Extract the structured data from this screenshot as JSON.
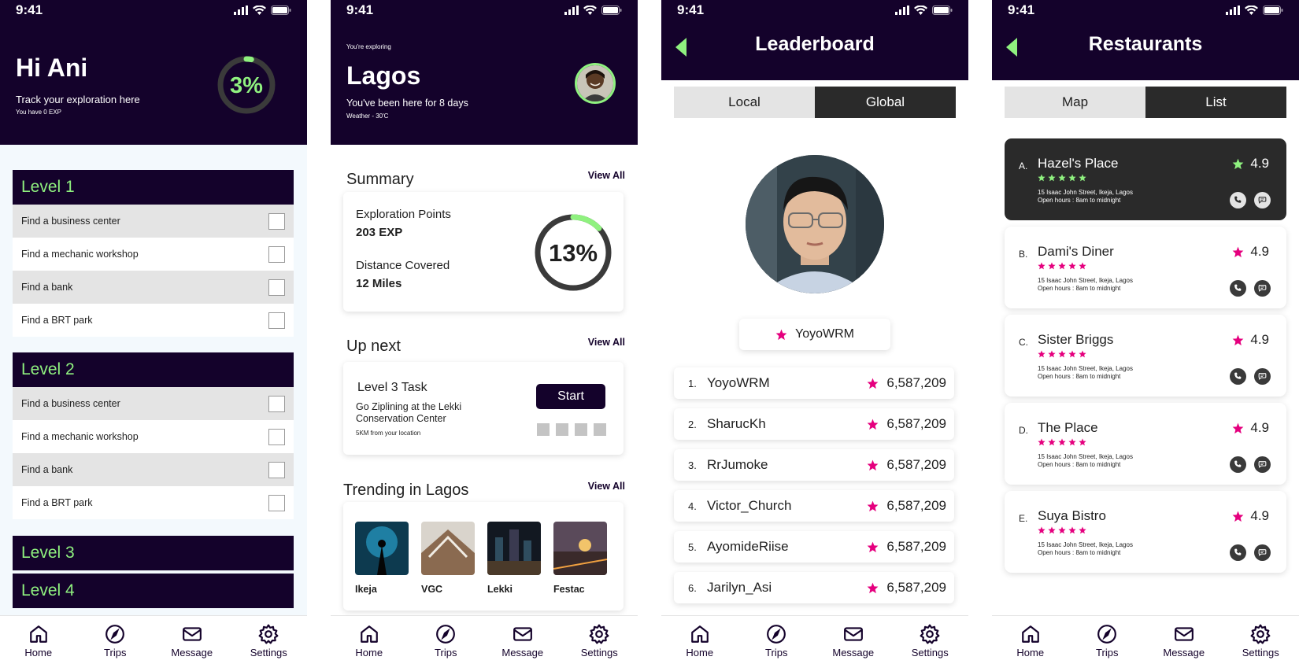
{
  "status_time": "9:41",
  "nav": [
    "Home",
    "Trips",
    "Message",
    "Settings"
  ],
  "colors": {
    "navy": "#14022b",
    "accent_green": "#8ff17f",
    "star_pink": "#e5007e",
    "dark_card": "#2a2a2a"
  },
  "screen1": {
    "greeting": "Hi Ani",
    "subtitle": "Track your exploration here",
    "exp_note": "You have 0 EXP",
    "progress_label": "3%",
    "progress": 0.03,
    "levels": [
      {
        "title": "Level 1",
        "tasks": [
          "Find a business center",
          "Find a mechanic workshop",
          "Find a bank",
          "Find a BRT park"
        ]
      },
      {
        "title": "Level 2",
        "tasks": [
          "Find a business center",
          "Find a mechanic workshop",
          "Find a bank",
          "Find a BRT park"
        ]
      },
      {
        "title": "Level 3"
      },
      {
        "title": "Level 4"
      }
    ]
  },
  "screen2": {
    "pre": "You're exploring",
    "city": "Lagos",
    "stay": "You've been here for 8 days",
    "weather": "Weather - 30'C",
    "summary_title": "Summary",
    "view_all": "View All",
    "exp_label": "Exploration Points",
    "exp_value": "203 EXP",
    "dist_label": "Distance Covered",
    "dist_value": "12 Miles",
    "progress_label": "13%",
    "progress": 0.13,
    "upnext_title": "Up next",
    "task_title": "Level 3 Task",
    "task_desc": "Go Ziplining at the Lekki Conservation Center",
    "task_dist": "5KM from your location",
    "start": "Start",
    "trending_title": "Trending in Lagos",
    "places": [
      "Ikeja",
      "VGC",
      "Lekki",
      "Festac"
    ]
  },
  "screen3": {
    "title": "Leaderboard",
    "tabs": [
      "Local",
      "Global"
    ],
    "active_tab": "Global",
    "user": "YoyoWRM",
    "rows": [
      {
        "rank": "1.",
        "name": "YoyoWRM",
        "score": "6,587,209"
      },
      {
        "rank": "2.",
        "name": "SharucKh",
        "score": "6,587,209"
      },
      {
        "rank": "3.",
        "name": "RrJumoke",
        "score": "6,587,209"
      },
      {
        "rank": "4.",
        "name": "Victor_Church",
        "score": "6,587,209"
      },
      {
        "rank": "5.",
        "name": "AyomideRiise",
        "score": "6,587,209"
      },
      {
        "rank": "6.",
        "name": "Jarilyn_Asi",
        "score": "6,587,209"
      }
    ]
  },
  "screen4": {
    "title": "Restaurants",
    "tabs": [
      "Map",
      "List"
    ],
    "active_tab": "List",
    "items": [
      {
        "letter": "A.",
        "name": "Hazel's Place",
        "rating": "4.9",
        "stars": 5,
        "address": "15 Isaac John Street, Ikeja, Lagos",
        "hours": "Open hours : 8am to midnight",
        "selected": true
      },
      {
        "letter": "B.",
        "name": "Dami's Diner",
        "rating": "4.9",
        "stars": 5,
        "address": "15 Isaac John Street, Ikeja, Lagos",
        "hours": "Open hours : 8am to midnight"
      },
      {
        "letter": "C.",
        "name": "Sister Briggs",
        "rating": "4.9",
        "stars": 5,
        "address": "15 Isaac John Street, Ikeja, Lagos",
        "hours": "Open hours : 8am to midnight"
      },
      {
        "letter": "D.",
        "name": "The Place",
        "rating": "4.9",
        "stars": 5,
        "address": "15 Isaac John Street, Ikeja, Lagos",
        "hours": "Open hours : 8am to midnight"
      },
      {
        "letter": "E.",
        "name": "Suya Bistro",
        "rating": "4.9",
        "stars": 5,
        "address": "15 Isaac John Street, Ikeja, Lagos",
        "hours": "Open hours : 8am to midnight"
      }
    ]
  }
}
